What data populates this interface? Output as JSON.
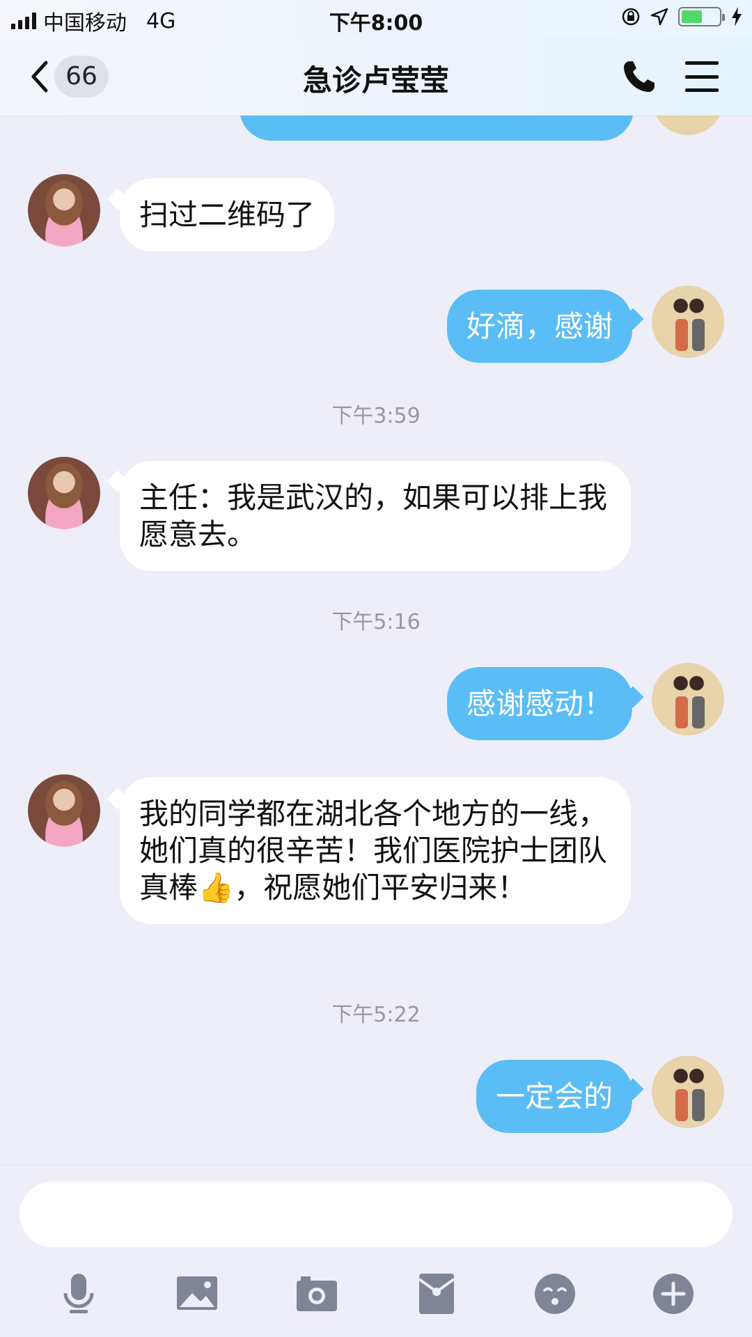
{
  "status_bar": {
    "carrier": "中国移动",
    "network": "4G",
    "time": "下午8:00",
    "battery_fraction": 0.55
  },
  "nav": {
    "unread_count": "66",
    "title": "急诊卢莹莹"
  },
  "messages": [
    {
      "side": "in",
      "text": "扫过二维码了"
    },
    {
      "side": "out",
      "text": "好滴，感谢"
    },
    {
      "type": "time",
      "text": "下午3:59"
    },
    {
      "side": "in",
      "text": "主任：我是武汉的，如果可以排上我愿意去。"
    },
    {
      "type": "time",
      "text": "下午5:16"
    },
    {
      "side": "out",
      "text": "感谢感动！"
    },
    {
      "side": "in",
      "text": "我的同学都在湖北各个地方的一线，她们真的很辛苦！我们医院护士团队真棒👍，祝愿她们平安归来！"
    },
    {
      "type": "time",
      "text": "下午5:22"
    },
    {
      "side": "out",
      "text": "一定会的"
    }
  ],
  "toolbar": {
    "icons": [
      "microphone-icon",
      "image-icon",
      "camera-icon",
      "red-packet-icon",
      "emoji-icon",
      "plus-icon"
    ]
  },
  "colors": {
    "background": "#eeeef8",
    "outgoing_bubble": "#5bbdf5",
    "incoming_bubble": "#ffffff",
    "icon_gray": "#7f8596"
  }
}
